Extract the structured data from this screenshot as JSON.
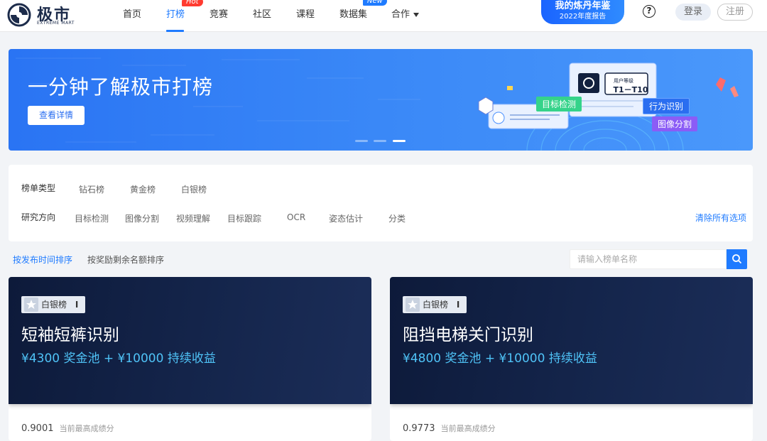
{
  "brand": {
    "name": "极市",
    "sub": "EXTREME MART"
  },
  "nav": {
    "items": [
      "首页",
      "打榜",
      "竞赛",
      "社区",
      "课程",
      "数据集",
      "合作"
    ],
    "hot_badge": "Hot",
    "new_badge": "New"
  },
  "report": {
    "line1": "我的炼丹年鉴",
    "line2": "2022年度报告"
  },
  "help": "?",
  "auth": {
    "login": "登录",
    "register": "注册"
  },
  "banner": {
    "title": "一分钟了解极市打榜",
    "button": "查看详情",
    "tags": [
      "目标检测",
      "行为识别",
      "图像分割"
    ],
    "user_card": {
      "label": "用户等级",
      "level": "T1－T10"
    }
  },
  "filters": {
    "type_label": "榜单类型",
    "types": [
      "钻石榜",
      "黄金榜",
      "白银榜"
    ],
    "direction_label": "研究方向",
    "directions": [
      "目标检测",
      "图像分割",
      "视频理解",
      "目标跟踪",
      "OCR",
      "姿态估计",
      "分类"
    ],
    "clear": "清除所有选项"
  },
  "sort": {
    "by_time": "按发布时间排序",
    "by_remaining": "按奖励剩余名额排序"
  },
  "search": {
    "placeholder": "请输入榜单名称"
  },
  "colors": {
    "primary": "#1f7bff",
    "card_bg": "#13224a",
    "prize": "#4fc3f7"
  },
  "cards": [
    {
      "badge": "白银榜",
      "badge_icon": "Ⅰ",
      "title": "短袖短裤识别",
      "prize": "¥4300 奖金池 + ¥10000 持续收益",
      "score": "0.9001",
      "score_label": "当前最高成绩分"
    },
    {
      "badge": "白银榜",
      "badge_icon": "Ⅰ",
      "title": "阻挡电梯关门识别",
      "prize": "¥4800 奖金池 + ¥10000 持续收益",
      "score": "0.9773",
      "score_label": "当前最高成绩分"
    }
  ]
}
